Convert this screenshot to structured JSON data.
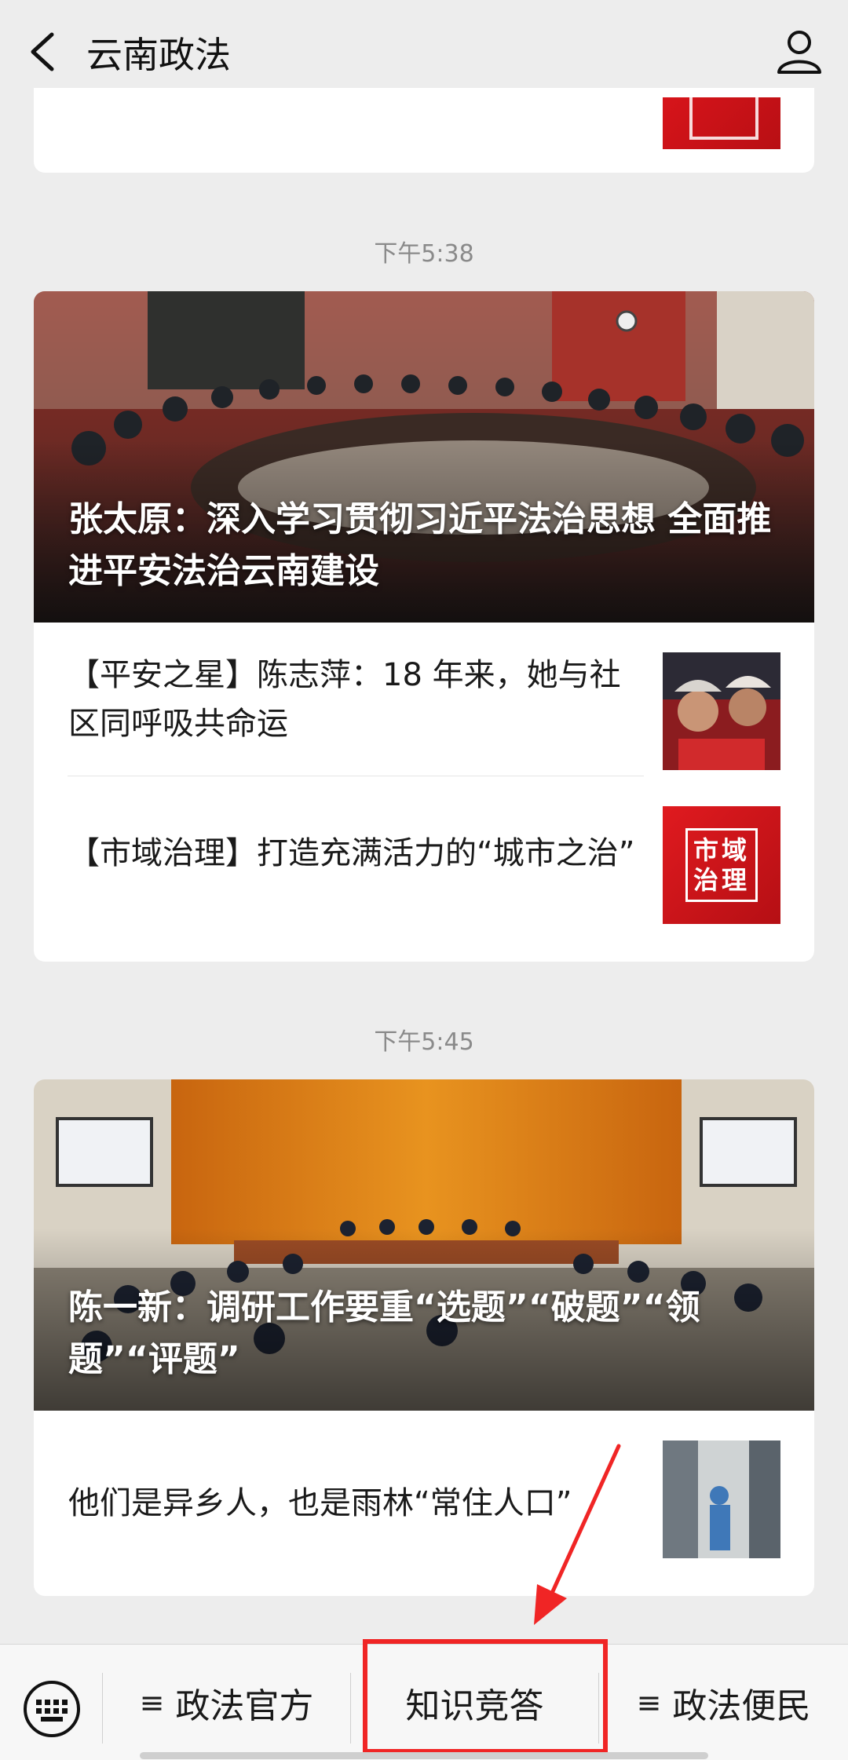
{
  "header": {
    "title": "云南政法"
  },
  "messages": [
    {
      "time": "下午5:38",
      "hero_title": "张太原：深入学习贯彻习近平法治思想 全面推进平安法治云南建设",
      "items": [
        {
          "text": "【平安之星】陈志萍：18 年来，她与社区同呼吸共命运"
        },
        {
          "text": "【市域治理】打造充满活力的“城市之治”",
          "thumb_text": "市域治理"
        }
      ]
    },
    {
      "time": "下午5:45",
      "hero_title": "陈一新：调研工作要重“选题”“破题”“领题”“评题”",
      "items": [
        {
          "text": "他们是异乡人，也是雨林“常住人口”"
        }
      ]
    }
  ],
  "bottom_menu": {
    "items": [
      {
        "label": "政法官方",
        "has_submenu_icon": true
      },
      {
        "label": "知识竞答",
        "has_submenu_icon": false
      },
      {
        "label": "政法便民",
        "has_submenu_icon": true
      }
    ],
    "submenu_glyph": "≡"
  },
  "colors": {
    "accent_red": "#f02525",
    "brand_red": "#d7141a"
  }
}
